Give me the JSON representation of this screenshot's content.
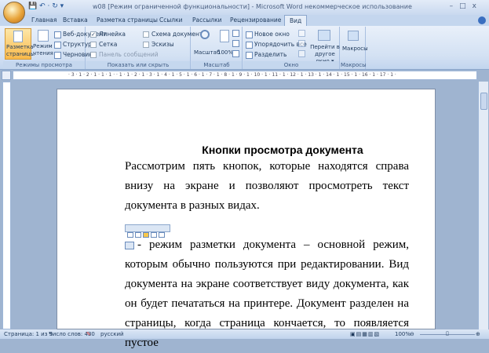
{
  "window": {
    "title": "w08 [Режим ограниченной функциональности] - Microsoft Word некоммерческое использование",
    "minimize": "–",
    "maximize": "□",
    "close": "x"
  },
  "tabs": [
    "Главная",
    "Вставка",
    "Разметка страницы",
    "Ссылки",
    "Рассылки",
    "Рецензирование",
    "Вид"
  ],
  "ribbon": {
    "views": {
      "label": "Режимы просмотра документа",
      "page_layout": "Разметка страницы",
      "reading": "Режим чтения",
      "web": "Веб-документ",
      "outline": "Структура",
      "draft": "Черновик"
    },
    "show": {
      "label": "Показать или скрыть",
      "ruler": "Линейка",
      "grid": "Сетка",
      "message_bar": "Панель сообщений",
      "doc_map": "Схема документа",
      "thumbs": "Эскизы"
    },
    "zoom": {
      "label": "Масштаб",
      "zoom": "Масштаб",
      "percent": "100%"
    },
    "window": {
      "label": "Окно",
      "new": "Новое окно",
      "arrange": "Упорядочить все",
      "split": "Разделить",
      "switch": "Перейти в другое окно ▾"
    },
    "macros": {
      "label": "Макросы",
      "macros": "Макросы"
    }
  },
  "ruler": "· 3 · 1 · 2 · 1 · 1 · 1 · · 1 · 1 · 2 · 1 · 3 · 1 · 4 · 1 · 5 · 1 · 6 · 1 · 7 · 1 · 8 · 1 · 9 · 1 · 10 · 1 · 11 · 1 · 12 · 1 · 13 · 1 · 14 · 1 · 15 · 1 · 16 · 1 · 17 · 1 ·",
  "document": {
    "heading": "Кнопки просмотра документа",
    "para1": "Рассмотрим пять кнопок, которые находятся справа внизу на экране и позволяют просмотреть текст документа в разных видах.",
    "para2": "- режим разметки документа – основной режим, которым обычно пользуются при редактировании. Вид документа на экране соответствует виду документа, как он будет печататься на принтере. Документ разделен на страницы, когда страница кончается, то появляется пустое"
  },
  "status": {
    "page": "Страница: 1 из 5",
    "words": "Число слов: 430",
    "lang": "русский",
    "zoom": "100%"
  }
}
